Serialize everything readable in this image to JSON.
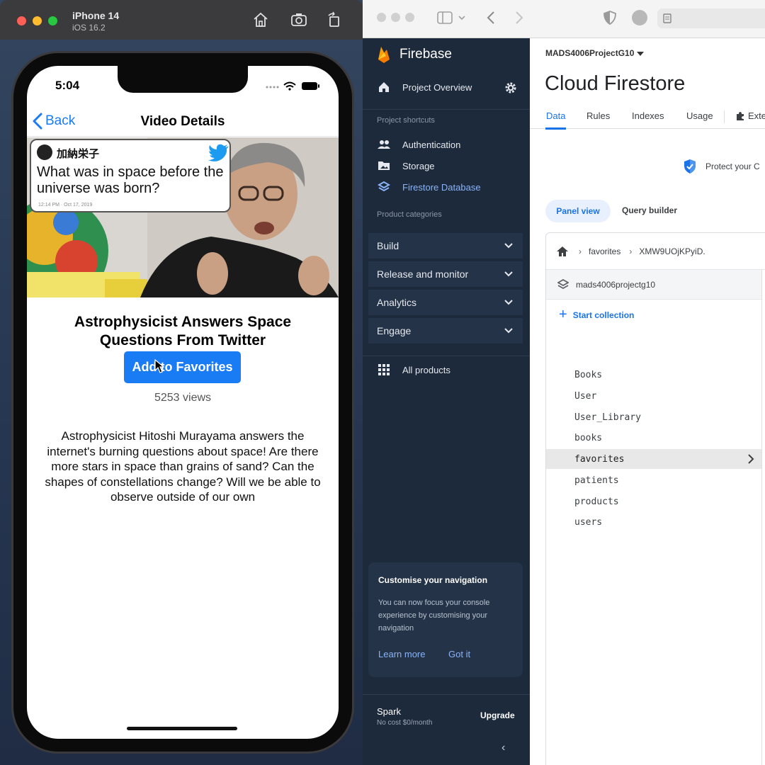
{
  "simulator": {
    "device_name": "iPhone 14",
    "os_version": "iOS 16.2"
  },
  "phone": {
    "status_time": "5:04",
    "nav": {
      "back_label": "Back",
      "title": "Video Details"
    },
    "thumbnail": {
      "tweet_author": "加納栄子",
      "tweet_text": "What was in space before the universe was born?",
      "tweet_date": "12:14 PM · Oct 17, 2019"
    },
    "video_title": "Astrophysicist Answers Space Questions From Twitter",
    "favorite_button": "Add to Favorites",
    "views": "5253 views",
    "description": "Astrophysicist Hitoshi Murayama answers the internet's burning questions about space!  Are there more stars in space than grains of sand? Can the shapes of constellations change? Will we be able to observe outside of our own"
  },
  "firebase": {
    "brand": "Firebase",
    "project_overview": "Project Overview",
    "shortcuts_heading": "Project shortcuts",
    "shortcuts": [
      "Authentication",
      "Storage",
      "Firestore Database"
    ],
    "categories_heading": "Product categories",
    "categories": [
      "Build",
      "Release and monitor",
      "Analytics",
      "Engage"
    ],
    "all_products": "All products",
    "nav_card": {
      "title": "Customise your navigation",
      "text": "You can now focus your console experience by customising your navigation",
      "learn_more": "Learn more",
      "got_it": "Got it"
    },
    "plan": {
      "name": "Spark",
      "cost": "No cost $0/month",
      "upgrade": "Upgrade"
    }
  },
  "firestore": {
    "project": "MADS4006ProjectG10",
    "title": "Cloud Firestore",
    "tabs": [
      "Data",
      "Rules",
      "Indexes",
      "Usage",
      "Exte"
    ],
    "protect_text": "Protect your C",
    "panel_view": "Panel view",
    "query_builder": "Query builder",
    "breadcrumb": [
      "favorites",
      "XMW9UOjKPyiD."
    ],
    "database": "mads4006projectg10",
    "start_collection": "Start collection",
    "collections": [
      "Books",
      "User",
      "User_Library",
      "books",
      "favorites",
      "patients",
      "products",
      "users"
    ],
    "selected_collection": "favorites",
    "colors": {
      "accent": "#1a73e8",
      "ios_blue": "#1a7cf5",
      "sidebar": "#1d2a3c"
    }
  }
}
